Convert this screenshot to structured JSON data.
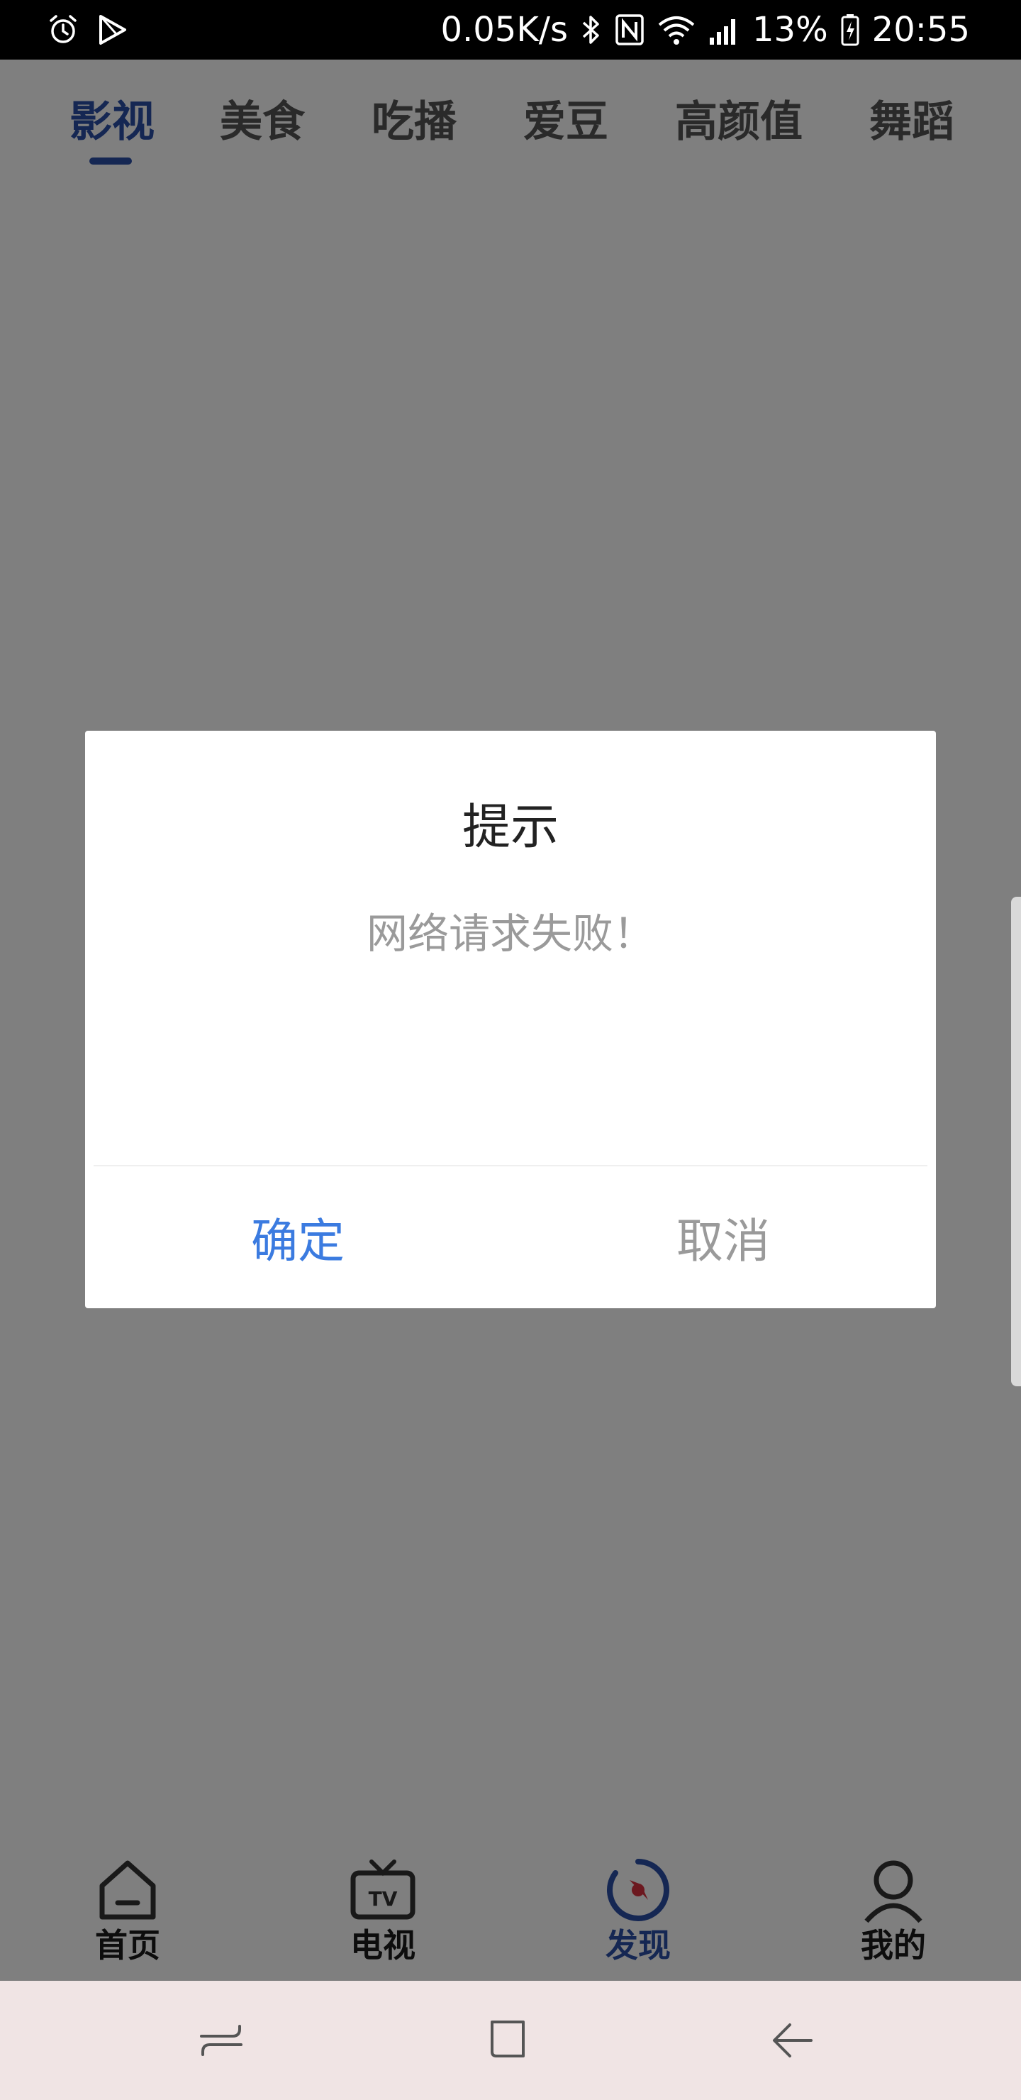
{
  "status_bar": {
    "net_speed": "0.05K/s",
    "battery_percent": "13%",
    "time": "20:55",
    "icons": [
      "alarm-icon",
      "play-store-icon",
      "bluetooth-icon",
      "nfc-icon",
      "wifi-icon",
      "signal-icon",
      "battery-charging-icon"
    ]
  },
  "top_tabs": {
    "items": [
      {
        "label": "影视",
        "active": true
      },
      {
        "label": "美食",
        "active": false
      },
      {
        "label": "吃播",
        "active": false
      },
      {
        "label": "爱豆",
        "active": false
      },
      {
        "label": "高颜值",
        "active": false
      },
      {
        "label": "舞蹈",
        "active": false
      }
    ]
  },
  "dialog": {
    "title": "提示",
    "message": "网络请求失败！",
    "confirm_label": "确定",
    "cancel_label": "取消"
  },
  "bottom_nav": {
    "items": [
      {
        "label": "首页",
        "icon": "home-icon",
        "active": false
      },
      {
        "label": "电视",
        "icon": "tv-icon",
        "active": false
      },
      {
        "label": "发现",
        "icon": "compass-icon",
        "active": true
      },
      {
        "label": "我的",
        "icon": "profile-icon",
        "active": false
      }
    ]
  },
  "system_nav": {
    "icons": [
      "recent-apps-icon",
      "home-button-icon",
      "back-icon"
    ]
  },
  "colors": {
    "accent": "#2b4fa6",
    "dialog_confirm": "#3b7be0",
    "overlay": "rgba(0,0,0,0.5)",
    "system_nav_bg": "#f0e4e4"
  }
}
